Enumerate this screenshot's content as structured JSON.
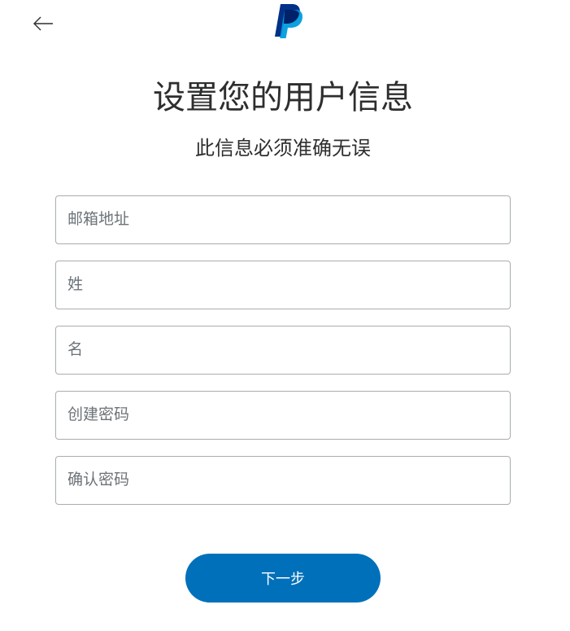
{
  "app": {
    "back_icon": "arrow-left-icon",
    "logo_icon": "paypal-logo-icon"
  },
  "header": {
    "title": "设置您的用户信息",
    "subtitle": "此信息必须准确无误"
  },
  "form": {
    "fields": [
      {
        "placeholder": "邮箱地址",
        "type": "email"
      },
      {
        "placeholder": "姓",
        "type": "text"
      },
      {
        "placeholder": "名",
        "type": "text"
      },
      {
        "placeholder": "创建密码",
        "type": "password"
      },
      {
        "placeholder": "确认密码",
        "type": "password"
      }
    ]
  },
  "actions": {
    "next_label": "下一步"
  },
  "colors": {
    "primary": "#0070ba",
    "logo_dark": "#003087",
    "logo_light": "#009cde",
    "text": "#2c2e2f",
    "placeholder": "#6c7378",
    "border": "#a8adb0"
  }
}
